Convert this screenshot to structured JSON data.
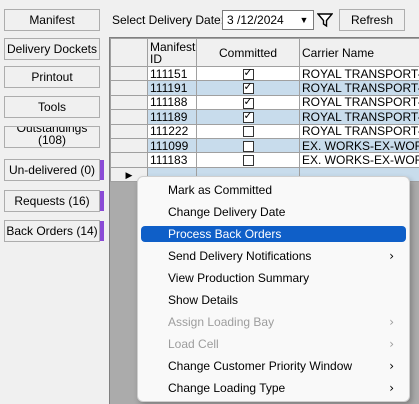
{
  "sidebar": {
    "manifest": "Manifest",
    "delivery_dockets": "Delivery Dockets",
    "printout": "Printout",
    "tools": "Tools",
    "outstandings_line1": "Outstandings",
    "outstandings_line2": "(108)",
    "undelivered": "Un-delivered (0)",
    "requests": "Requests (16)",
    "back_orders": "Back Orders (14)"
  },
  "toolbar": {
    "date_label": "Select Delivery Date:",
    "date_value": "3 /12/2024",
    "refresh": "Refresh"
  },
  "grid": {
    "columns": [
      "Manifest ID",
      "Committed",
      "Carrier Name"
    ],
    "rows": [
      {
        "id": "111151",
        "committed": true,
        "carrier": "ROYAL TRANSPORT-UN"
      },
      {
        "id": "111191",
        "committed": true,
        "carrier": "ROYAL TRANSPORT-UN"
      },
      {
        "id": "111188",
        "committed": true,
        "carrier": "ROYAL TRANSPORT-GR"
      },
      {
        "id": "111189",
        "committed": true,
        "carrier": "ROYAL TRANSPORT-NE"
      },
      {
        "id": "111222",
        "committed": false,
        "carrier": "ROYAL TRANSPORT-UN"
      },
      {
        "id": "111099",
        "committed": false,
        "carrier": "EX. WORKS-EX-WORKS"
      },
      {
        "id": "111183",
        "committed": false,
        "carrier": "EX. WORKS-EX-WORKS"
      }
    ]
  },
  "context_menu": {
    "items": [
      {
        "label": "Mark as Committed",
        "submenu": false,
        "disabled": false
      },
      {
        "label": "Change Delivery Date",
        "submenu": false,
        "disabled": false
      },
      {
        "label": "Process Back Orders",
        "submenu": false,
        "disabled": false,
        "highlighted": true
      },
      {
        "label": "Send Delivery Notifications",
        "submenu": true,
        "disabled": false
      },
      {
        "label": "View Production Summary",
        "submenu": false,
        "disabled": false
      },
      {
        "label": "Show Details",
        "submenu": false,
        "disabled": false
      },
      {
        "label": "Assign Loading Bay",
        "submenu": true,
        "disabled": true
      },
      {
        "label": "Load Cell",
        "submenu": true,
        "disabled": true
      },
      {
        "label": "Change Customer Priority Window",
        "submenu": true,
        "disabled": false
      },
      {
        "label": "Change Loading Type",
        "submenu": true,
        "disabled": false
      }
    ]
  },
  "colors": {
    "accent_flag": "#8a4bd6",
    "menu_highlight": "#0f5fc8",
    "row_highlight": "#c8dcec"
  }
}
